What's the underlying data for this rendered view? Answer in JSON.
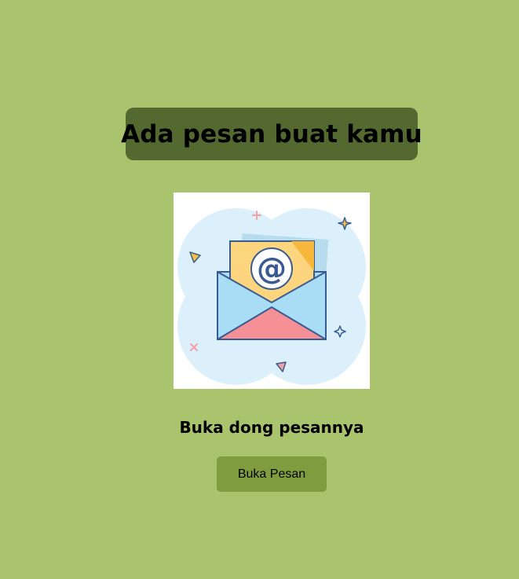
{
  "header": {
    "title": "Ada pesan buat kamu"
  },
  "main": {
    "illustration_icon": "envelope-at-icon",
    "subtitle": "Buka dong pesannya",
    "button_label": "Buka Pesan"
  },
  "colors": {
    "background": "#a9c46c",
    "title_box": "#53692f",
    "button": "#7f9c3f"
  }
}
